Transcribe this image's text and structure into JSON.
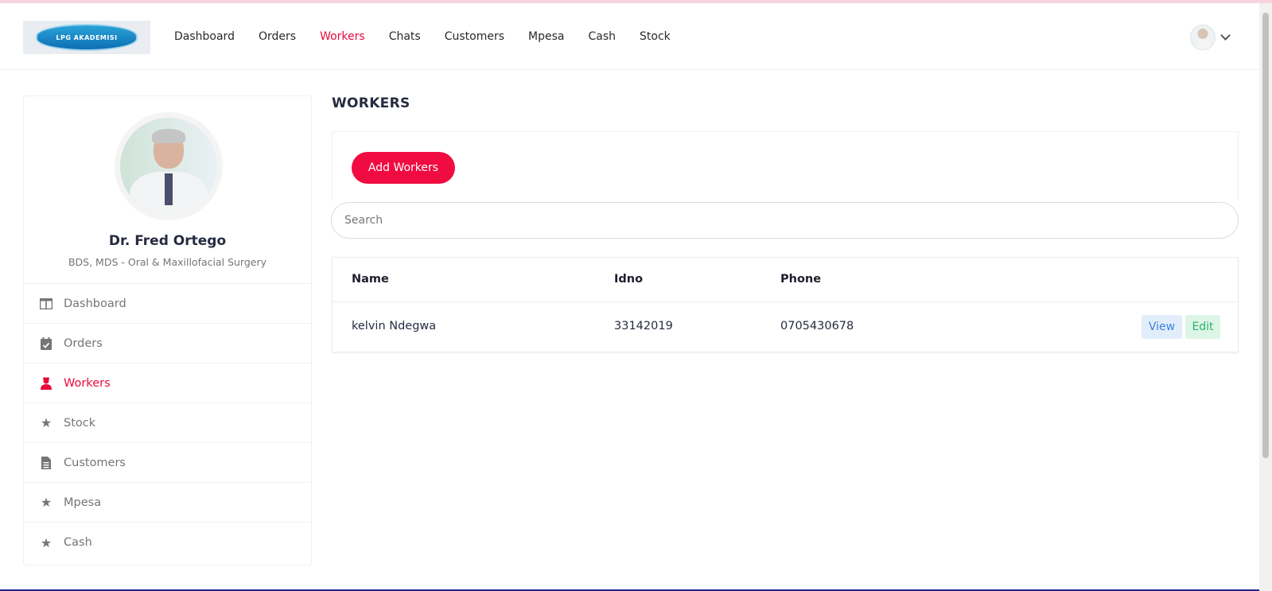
{
  "header": {
    "logo_text": "LPG AKADEMISI",
    "nav": [
      {
        "label": "Dashboard",
        "active": false
      },
      {
        "label": "Orders",
        "active": false
      },
      {
        "label": "Workers",
        "active": true
      },
      {
        "label": "Chats",
        "active": false
      },
      {
        "label": "Customers",
        "active": false
      },
      {
        "label": "Mpesa",
        "active": false
      },
      {
        "label": "Cash",
        "active": false
      },
      {
        "label": "Stock",
        "active": false
      }
    ]
  },
  "profile": {
    "name": "Dr. Fred Ortego",
    "subtitle": "BDS, MDS - Oral & Maxillofacial Surgery"
  },
  "sidebar": {
    "items": [
      {
        "label": "Dashboard",
        "icon": "columns-icon",
        "active": false
      },
      {
        "label": "Orders",
        "icon": "calendar-check-icon",
        "active": false
      },
      {
        "label": "Workers",
        "icon": "user-worker-icon",
        "active": true
      },
      {
        "label": "Stock",
        "icon": "star-icon",
        "active": false
      },
      {
        "label": "Customers",
        "icon": "document-icon",
        "active": false
      },
      {
        "label": "Mpesa",
        "icon": "star-icon",
        "active": false
      },
      {
        "label": "Cash",
        "icon": "star-icon",
        "active": false
      }
    ]
  },
  "main": {
    "title": "WORKERS",
    "add_button": "Add Workers",
    "search_placeholder": "Search",
    "table": {
      "headers": [
        "Name",
        "Idno",
        "Phone"
      ],
      "rows": [
        {
          "name": "kelvin Ndegwa",
          "idno": "33142019",
          "phone": "0705430678",
          "view": "View",
          "edit": "Edit"
        }
      ]
    }
  },
  "colors": {
    "accent": "#e8093b",
    "view_bg": "#e2edfb",
    "edit_bg": "#dcf5e6"
  }
}
